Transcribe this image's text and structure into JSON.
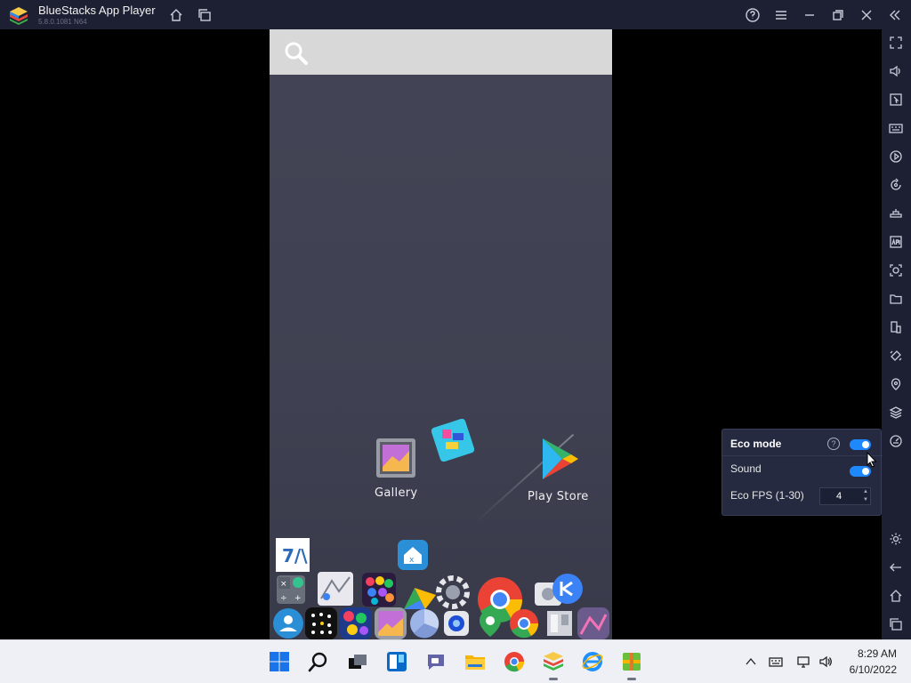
{
  "window": {
    "title": "BlueStacks App Player",
    "version": "5.8.0.1081 N64"
  },
  "android": {
    "desktop_icons": [
      {
        "name": "gallery",
        "label": "Gallery"
      },
      {
        "name": "play-store",
        "label": "Play Store"
      }
    ]
  },
  "eco_panel": {
    "title": "Eco mode",
    "help": "?",
    "sound_label": "Sound",
    "fps_label": "Eco FPS (1-30)",
    "fps_value": "4",
    "eco_enabled": true,
    "sound_enabled": true
  },
  "taskbar": {
    "time": "8:29 AM",
    "date": "6/10/2022"
  },
  "colors": {
    "titlebar": "#1d2032",
    "accent": "#1e88ff",
    "android_bg": "#434556",
    "taskbar": "#eef0f6"
  }
}
